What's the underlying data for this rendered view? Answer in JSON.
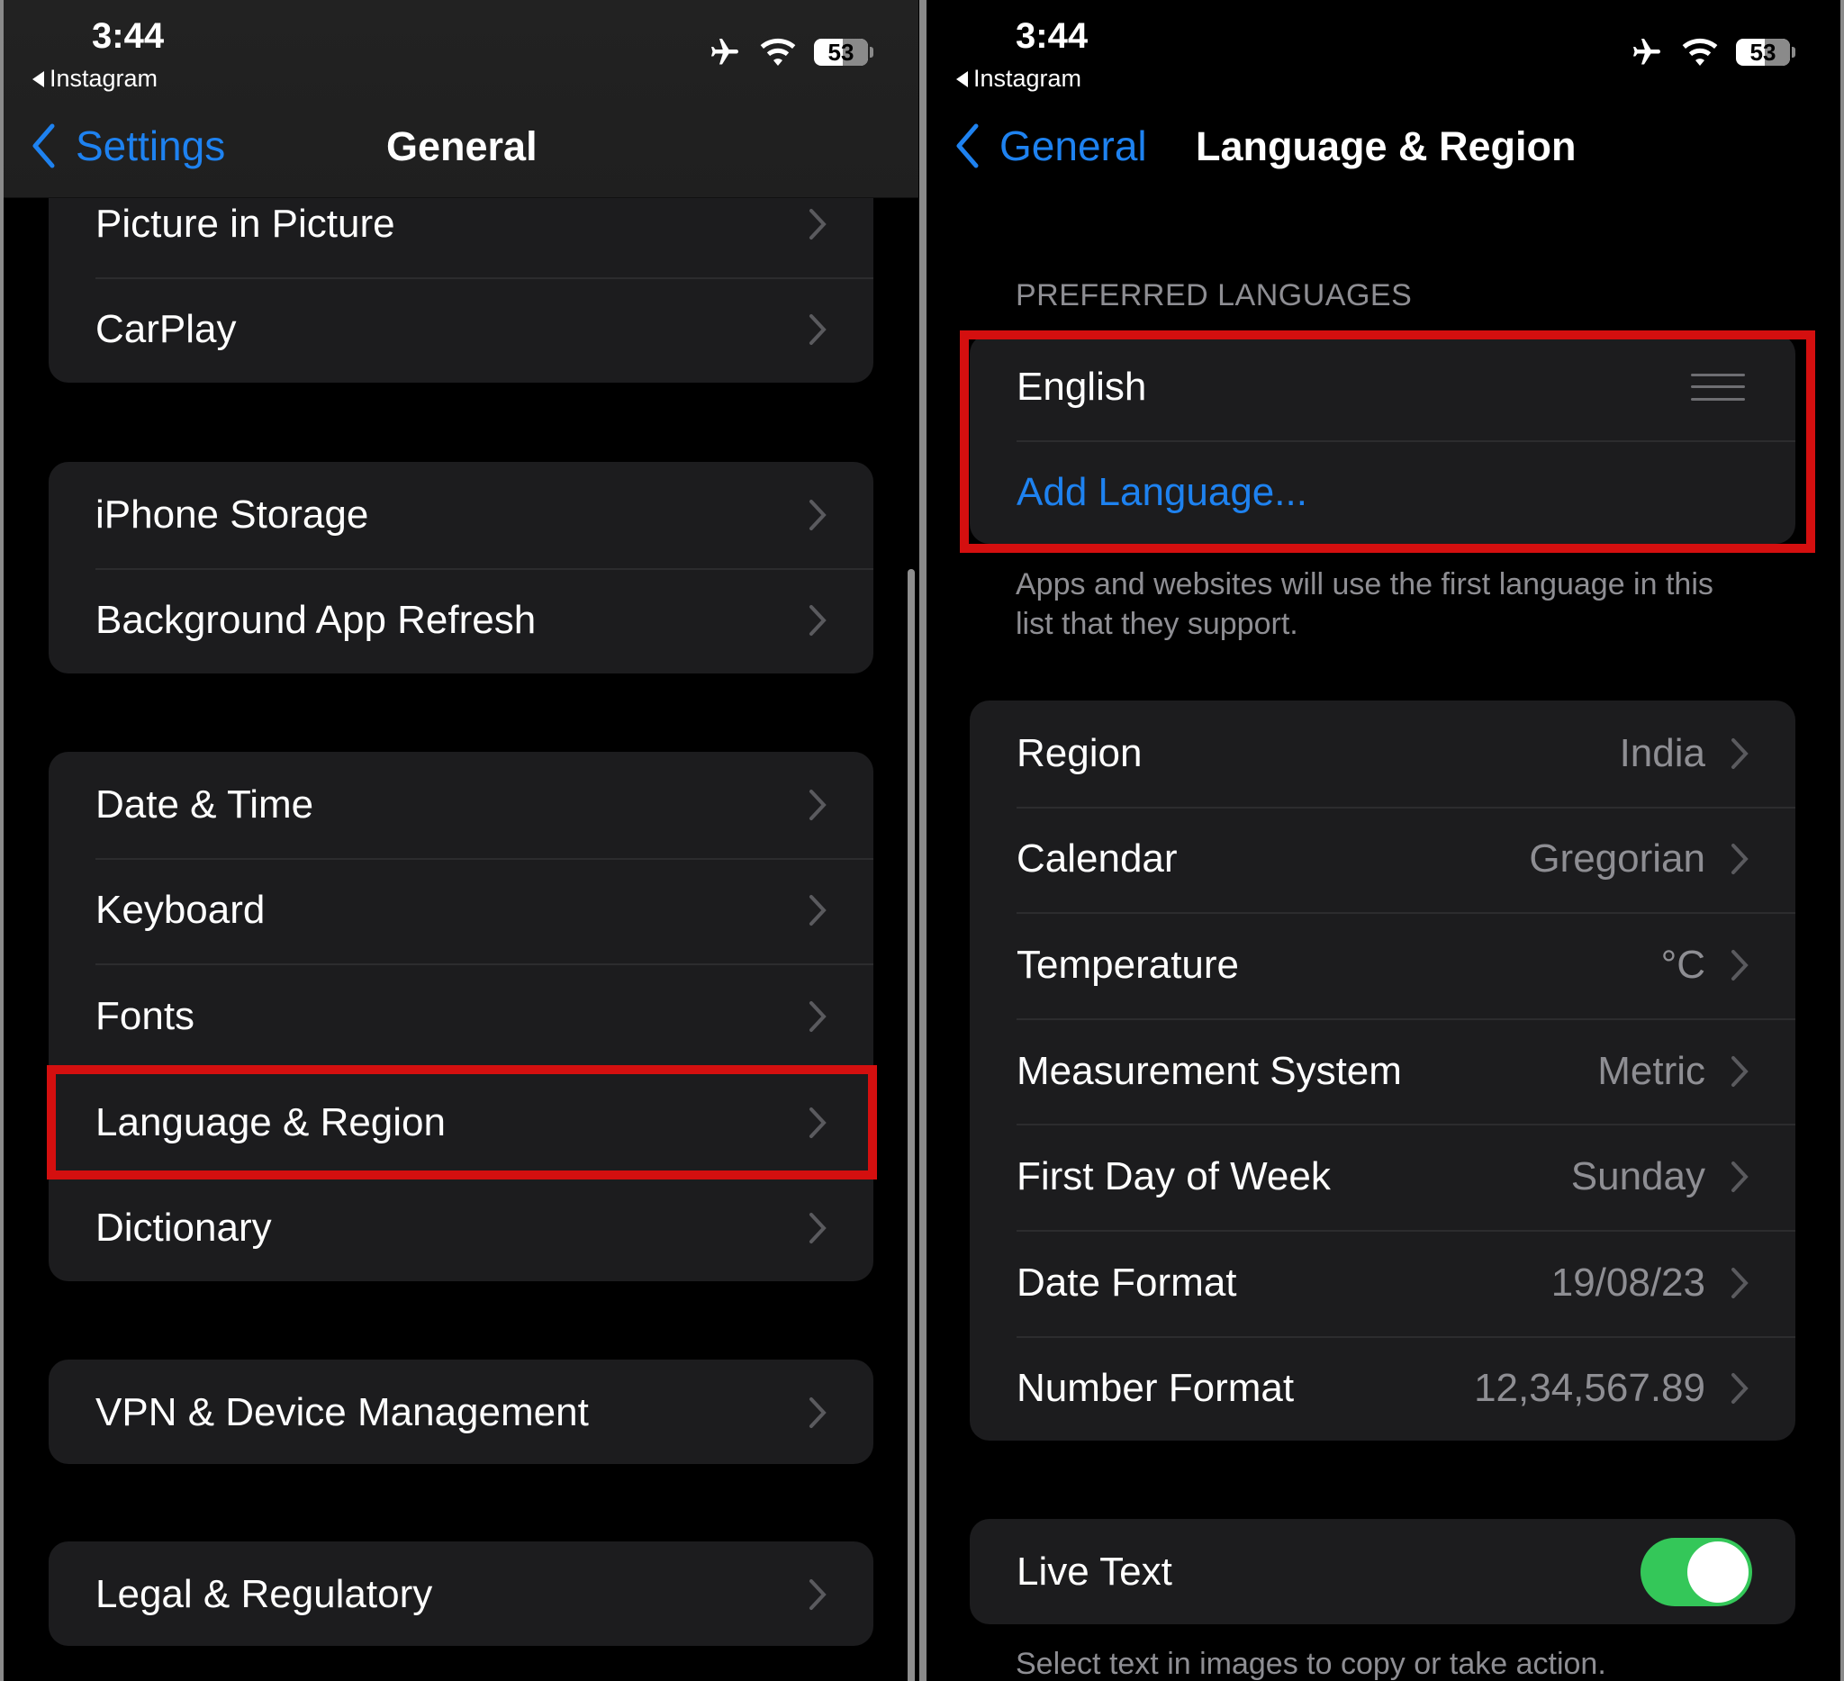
{
  "left": {
    "status": {
      "time": "3:44",
      "back_app": "Instagram",
      "battery": "53"
    },
    "nav": {
      "back_label": "Settings",
      "title": "General"
    },
    "groups": [
      {
        "items": [
          {
            "label": "Picture in Picture"
          },
          {
            "label": "CarPlay"
          }
        ]
      },
      {
        "items": [
          {
            "label": "iPhone Storage"
          },
          {
            "label": "Background App Refresh"
          }
        ]
      },
      {
        "items": [
          {
            "label": "Date & Time"
          },
          {
            "label": "Keyboard"
          },
          {
            "label": "Fonts"
          },
          {
            "label": "Language & Region",
            "highlighted": true
          },
          {
            "label": "Dictionary"
          }
        ]
      },
      {
        "items": [
          {
            "label": "VPN & Device Management"
          }
        ]
      },
      {
        "items": [
          {
            "label": "Legal & Regulatory"
          }
        ]
      }
    ]
  },
  "right": {
    "status": {
      "time": "3:44",
      "back_app": "Instagram",
      "battery": "53"
    },
    "nav": {
      "back_label": "General",
      "title": "Language & Region"
    },
    "preferred_languages": {
      "header": "PREFERRED LANGUAGES",
      "languages": [
        {
          "label": "English"
        }
      ],
      "add_language": "Add Language...",
      "footer": "Apps and websites will use the first language in this list that they support."
    },
    "region_settings": [
      {
        "label": "Region",
        "value": "India"
      },
      {
        "label": "Calendar",
        "value": "Gregorian"
      },
      {
        "label": "Temperature",
        "value": "°C"
      },
      {
        "label": "Measurement System",
        "value": "Metric"
      },
      {
        "label": "First Day of Week",
        "value": "Sunday"
      },
      {
        "label": "Date Format",
        "value": "19/08/23"
      },
      {
        "label": "Number Format",
        "value": "12,34,567.89"
      }
    ],
    "live_text": {
      "label": "Live Text",
      "enabled": true,
      "footer": "Select text in images to copy or take action."
    }
  },
  "colors": {
    "accent": "#1e82f0",
    "highlight": "#d40f0f",
    "toggle_on": "#34c759",
    "cell_bg": "#1c1c1e",
    "secondary_text": "#8e8e93"
  }
}
